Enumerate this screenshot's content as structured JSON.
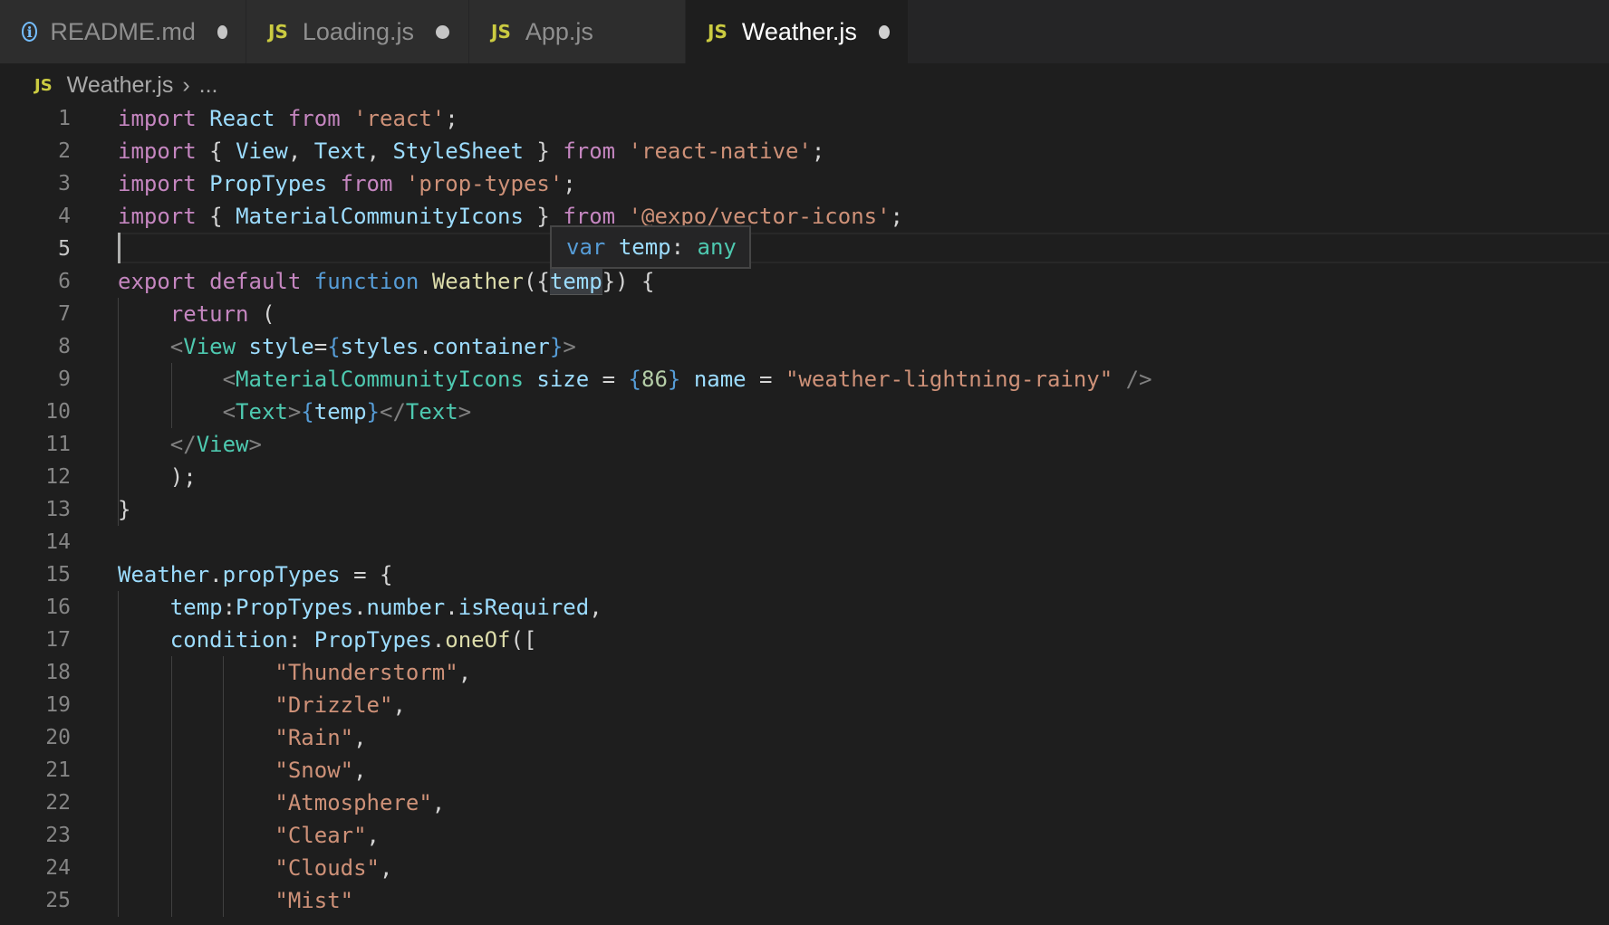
{
  "tabs": [
    {
      "label": "README.md",
      "icon": "info-icon",
      "dirty": true,
      "active": false
    },
    {
      "label": "Loading.js",
      "icon": "js-icon",
      "dirty": true,
      "active": false
    },
    {
      "label": "App.js",
      "icon": "js-icon",
      "dirty": false,
      "active": false
    },
    {
      "label": "Weather.js",
      "icon": "js-icon",
      "dirty": true,
      "active": true
    }
  ],
  "breadcrumb": {
    "icon_text": "JS",
    "file": "Weather.js",
    "more": "..."
  },
  "js_icon_text": "JS",
  "info_icon_text": "i",
  "hover": {
    "keyword": "var",
    "name": "temp",
    "colon": ":",
    "type": "any"
  },
  "current_line": 5,
  "lines": [
    {
      "n": "1",
      "tokens": [
        [
          "kw",
          "import"
        ],
        [
          "pun",
          " "
        ],
        [
          "var",
          "React"
        ],
        [
          "pun",
          " "
        ],
        [
          "kw",
          "from"
        ],
        [
          "pun",
          " "
        ],
        [
          "str",
          "'react'"
        ],
        [
          "pun",
          ";"
        ]
      ]
    },
    {
      "n": "2",
      "tokens": [
        [
          "kw",
          "import"
        ],
        [
          "pun",
          " { "
        ],
        [
          "var",
          "View"
        ],
        [
          "pun",
          ", "
        ],
        [
          "var",
          "Text"
        ],
        [
          "pun",
          ", "
        ],
        [
          "var",
          "StyleSheet"
        ],
        [
          "pun",
          " } "
        ],
        [
          "kw",
          "from"
        ],
        [
          "pun",
          " "
        ],
        [
          "str",
          "'react-native'"
        ],
        [
          "pun",
          ";"
        ]
      ]
    },
    {
      "n": "3",
      "tokens": [
        [
          "kw",
          "import"
        ],
        [
          "pun",
          " "
        ],
        [
          "var",
          "PropTypes"
        ],
        [
          "pun",
          " "
        ],
        [
          "kw",
          "from"
        ],
        [
          "pun",
          " "
        ],
        [
          "str",
          "'prop-types'"
        ],
        [
          "pun",
          ";"
        ]
      ]
    },
    {
      "n": "4",
      "tokens": [
        [
          "kw",
          "import"
        ],
        [
          "pun",
          " { "
        ],
        [
          "var",
          "MaterialCommunityIcons"
        ],
        [
          "pun",
          " } "
        ],
        [
          "kw",
          "from"
        ],
        [
          "pun",
          " "
        ],
        [
          "str",
          "'@expo/vector-icons'"
        ],
        [
          "pun",
          ";"
        ]
      ]
    },
    {
      "n": "5",
      "tokens": []
    },
    {
      "n": "6",
      "tokens": [
        [
          "kw",
          "export"
        ],
        [
          "pun",
          " "
        ],
        [
          "kw",
          "default"
        ],
        [
          "pun",
          " "
        ],
        [
          "st",
          "function"
        ],
        [
          "pun",
          " "
        ],
        [
          "fn",
          "Weather"
        ],
        [
          "pun",
          "({"
        ],
        [
          "var hl-ref",
          "temp"
        ],
        [
          "pun",
          "}) {"
        ]
      ]
    },
    {
      "n": "7",
      "tokens": [
        [
          "pun",
          "    "
        ],
        [
          "kw",
          "return"
        ],
        [
          "pun",
          " ("
        ]
      ]
    },
    {
      "n": "8",
      "tokens": [
        [
          "pun",
          "    "
        ],
        [
          "tag",
          "<"
        ],
        [
          "cls",
          "View"
        ],
        [
          "pun",
          " "
        ],
        [
          "var",
          "style"
        ],
        [
          "pun",
          "="
        ],
        [
          "brace",
          "{"
        ],
        [
          "var",
          "styles"
        ],
        [
          "pun",
          "."
        ],
        [
          "var",
          "container"
        ],
        [
          "brace",
          "}"
        ],
        [
          "tag",
          ">"
        ]
      ]
    },
    {
      "n": "9",
      "tokens": [
        [
          "pun",
          "        "
        ],
        [
          "tag",
          "<"
        ],
        [
          "cls",
          "MaterialCommunityIcons"
        ],
        [
          "pun",
          " "
        ],
        [
          "var",
          "size"
        ],
        [
          "pun",
          " = "
        ],
        [
          "brace",
          "{"
        ],
        [
          "num",
          "86"
        ],
        [
          "brace",
          "}"
        ],
        [
          "pun",
          " "
        ],
        [
          "var",
          "name"
        ],
        [
          "pun",
          " = "
        ],
        [
          "str",
          "\"weather-lightning-rainy\""
        ],
        [
          "pun",
          " "
        ],
        [
          "tag",
          "/>"
        ]
      ]
    },
    {
      "n": "10",
      "tokens": [
        [
          "pun",
          "        "
        ],
        [
          "tag",
          "<"
        ],
        [
          "cls",
          "Text"
        ],
        [
          "tag",
          ">"
        ],
        [
          "brace",
          "{"
        ],
        [
          "var",
          "temp"
        ],
        [
          "brace",
          "}"
        ],
        [
          "tag",
          "</"
        ],
        [
          "cls",
          "Text"
        ],
        [
          "tag",
          ">"
        ]
      ]
    },
    {
      "n": "11",
      "tokens": [
        [
          "pun",
          "    "
        ],
        [
          "tag",
          "</"
        ],
        [
          "cls",
          "View"
        ],
        [
          "tag",
          ">"
        ]
      ]
    },
    {
      "n": "12",
      "tokens": [
        [
          "pun",
          "    );"
        ]
      ]
    },
    {
      "n": "13",
      "tokens": [
        [
          "pun",
          "}"
        ]
      ]
    },
    {
      "n": "14",
      "tokens": []
    },
    {
      "n": "15",
      "tokens": [
        [
          "var",
          "Weather"
        ],
        [
          "pun",
          "."
        ],
        [
          "var",
          "propTypes"
        ],
        [
          "pun",
          " = {"
        ]
      ]
    },
    {
      "n": "16",
      "tokens": [
        [
          "pun",
          "    "
        ],
        [
          "var",
          "temp"
        ],
        [
          "pun",
          ":"
        ],
        [
          "var",
          "PropTypes"
        ],
        [
          "pun",
          "."
        ],
        [
          "var",
          "number"
        ],
        [
          "pun",
          "."
        ],
        [
          "var",
          "isRequired"
        ],
        [
          "pun",
          ","
        ]
      ]
    },
    {
      "n": "17",
      "tokens": [
        [
          "pun",
          "    "
        ],
        [
          "var",
          "condition"
        ],
        [
          "pun",
          ": "
        ],
        [
          "var",
          "PropTypes"
        ],
        [
          "pun",
          "."
        ],
        [
          "fn",
          "oneOf"
        ],
        [
          "pun",
          "(["
        ]
      ]
    },
    {
      "n": "18",
      "tokens": [
        [
          "pun",
          "            "
        ],
        [
          "str",
          "\"Thunderstorm\""
        ],
        [
          "pun",
          ","
        ]
      ]
    },
    {
      "n": "19",
      "tokens": [
        [
          "pun",
          "            "
        ],
        [
          "str",
          "\"Drizzle\""
        ],
        [
          "pun",
          ","
        ]
      ]
    },
    {
      "n": "20",
      "tokens": [
        [
          "pun",
          "            "
        ],
        [
          "str",
          "\"Rain\""
        ],
        [
          "pun",
          ","
        ]
      ]
    },
    {
      "n": "21",
      "tokens": [
        [
          "pun",
          "            "
        ],
        [
          "str",
          "\"Snow\""
        ],
        [
          "pun",
          ","
        ]
      ]
    },
    {
      "n": "22",
      "tokens": [
        [
          "pun",
          "            "
        ],
        [
          "str",
          "\"Atmosphere\""
        ],
        [
          "pun",
          ","
        ]
      ]
    },
    {
      "n": "23",
      "tokens": [
        [
          "pun",
          "            "
        ],
        [
          "str",
          "\"Clear\""
        ],
        [
          "pun",
          ","
        ]
      ]
    },
    {
      "n": "24",
      "tokens": [
        [
          "pun",
          "            "
        ],
        [
          "str",
          "\"Clouds\""
        ],
        [
          "pun",
          ","
        ]
      ]
    },
    {
      "n": "25",
      "tokens": [
        [
          "pun",
          "            "
        ],
        [
          "str",
          "\"Mist\""
        ]
      ]
    }
  ]
}
